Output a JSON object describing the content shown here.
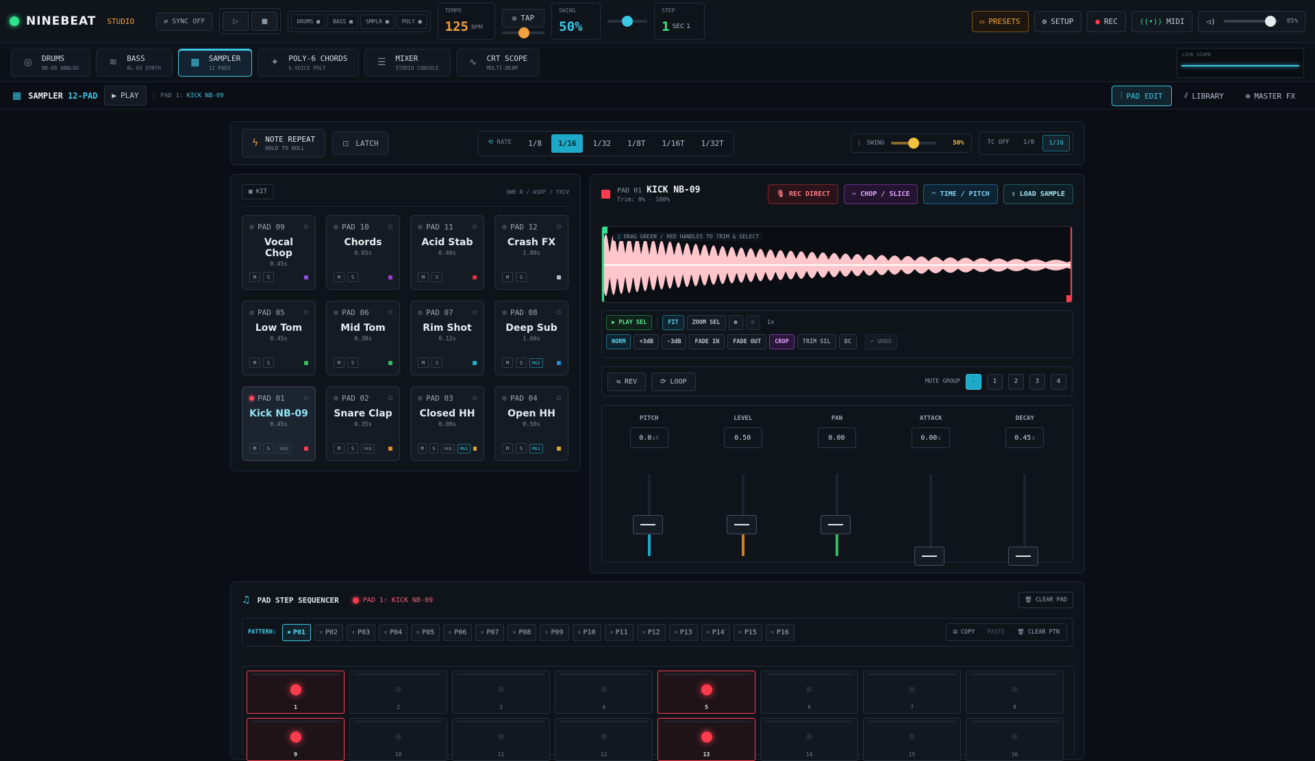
{
  "app": {
    "name": "NINEBEAT",
    "sub": "STUDIO"
  },
  "topbar": {
    "sync": "SYNC OFF",
    "channels": [
      "DRUMS",
      "BASS",
      "SMPLR",
      "POLY"
    ],
    "tempo": {
      "label": "TEMPO",
      "value": "125",
      "unit": "BPM"
    },
    "tap": "TAP",
    "swing": {
      "label": "SWING",
      "value": "50%"
    },
    "step": {
      "label": "STEP",
      "value": "1",
      "sec": "SEC 1"
    },
    "presets": "PRESETS",
    "setup": "SETUP",
    "rec": "REC",
    "midi": "MIDI",
    "volume": "85%",
    "volume_level": 0.85
  },
  "modules": [
    {
      "name": "DRUMS",
      "sub": "NB-09 ANALOG",
      "icon": "drum-icon"
    },
    {
      "name": "BASS",
      "sub": "AL-03 SYNTH",
      "icon": "bass-icon"
    },
    {
      "name": "SAMPLER",
      "sub": "12 PADS",
      "icon": "grid-icon"
    },
    {
      "name": "POLY-6 CHORDS",
      "sub": "6-VOICE POLY",
      "icon": "sparkle-icon"
    },
    {
      "name": "MIXER",
      "sub": "STUDIO CONSOLE",
      "icon": "sliders-icon"
    },
    {
      "name": "CRT SCOPE",
      "sub": "MULTI-BEAM",
      "icon": "pulse-icon"
    }
  ],
  "live_scope": "LIVE SCOPE",
  "sampler_bar": {
    "title": "SAMPLER",
    "title_accent": "12-PAD",
    "play": "PLAY",
    "pad_prefix": "PAD 1:",
    "pad_name": "KICK NB-09",
    "views": [
      "PAD EDIT",
      "LIBRARY",
      "MASTER FX"
    ]
  },
  "note_repeat": {
    "title": "NOTE REPEAT",
    "sub": "HOLD TO ROLL",
    "latch": "LATCH",
    "rate_label": "RATE",
    "rates": [
      "1/8",
      "1/16",
      "1/32",
      "1/8T",
      "1/16T",
      "1/32T"
    ],
    "swing_label": "SWING",
    "swing_value": "50%",
    "swing_level": 0.5,
    "tc": [
      "TC OFF",
      "1/8",
      "1/16"
    ]
  },
  "kit": {
    "label": "KIT",
    "keys": "QWE R / ASDF / YXCV",
    "pads": [
      {
        "id": "PAD 09",
        "name": "Vocal Chop",
        "time": "0.45s",
        "dot": "#8b4fe0",
        "tags": []
      },
      {
        "id": "PAD 10",
        "name": "Chords",
        "time": "0.65s",
        "dot": "#a03bd6",
        "tags": []
      },
      {
        "id": "PAD 11",
        "name": "Acid Stab",
        "time": "0.40s",
        "dot": "#e03447",
        "tags": []
      },
      {
        "id": "PAD 12",
        "name": "Crash FX",
        "time": "1.80s",
        "dot": "#b8bfc8",
        "tags": []
      },
      {
        "id": "PAD 05",
        "name": "Low Tom",
        "time": "0.45s",
        "dot": "#2fbf5f",
        "tags": []
      },
      {
        "id": "PAD 06",
        "name": "Mid Tom",
        "time": "0.38s",
        "dot": "#2fbf5f",
        "tags": []
      },
      {
        "id": "PAD 07",
        "name": "Rim Shot",
        "time": "0.12s",
        "dot": "#1fb3cf",
        "tags": []
      },
      {
        "id": "PAD 08",
        "name": "Deep Sub",
        "time": "1.60s",
        "dot": "#1f8fd6",
        "tags": [
          "MG2"
        ]
      },
      {
        "id": "PAD 01",
        "name": "Kick NB-09",
        "time": "0.45s",
        "dot": "#ff3b4e",
        "tags": [
          "SEQ"
        ],
        "active": true
      },
      {
        "id": "PAD 02",
        "name": "Snare Clap",
        "time": "0.35s",
        "dot": "#e08a2b",
        "tags": [
          "SEQ"
        ]
      },
      {
        "id": "PAD 03",
        "name": "Closed HH",
        "time": "0.08s",
        "dot": "#e0a62b",
        "tags": [
          "SEQ",
          "MG1"
        ]
      },
      {
        "id": "PAD 04",
        "name": "Open HH",
        "time": "0.50s",
        "dot": "#e0a62b",
        "tags": [
          "MG1"
        ]
      }
    ]
  },
  "editor": {
    "pad": "PAD 01",
    "name": "KICK NB-09",
    "trim": "Trim: 0% - 100%",
    "rec_direct": "REC DIRECT",
    "chop": "CHOP / SLICE",
    "time_pitch": "TIME / PITCH",
    "load": "LOAD SAMPLE",
    "wave_hint": "DRAG GREEN / RED HANDLES TO TRIM & SELECT",
    "tools_row1": [
      "PLAY SEL",
      "FIT",
      "ZOOM SEL",
      "1x"
    ],
    "tools_row2": [
      "NORM",
      "+3dB",
      "-3dB",
      "FADE IN",
      "FADE OUT",
      "CROP",
      "TRIM SIL",
      "DC",
      "UNDO"
    ],
    "rev": "REV",
    "loop": "LOOP",
    "mute_group_label": "MUTE GROUP",
    "mute_groups": [
      "-",
      "1",
      "2",
      "3",
      "4"
    ],
    "params": [
      {
        "label": "PITCH",
        "value": "0.0",
        "unit": "st",
        "level": 0.5,
        "color": "#1fa9c8"
      },
      {
        "label": "LEVEL",
        "value": "0.50",
        "unit": "",
        "level": 0.5,
        "color": "#c9821f"
      },
      {
        "label": "PAN",
        "value": "0.00",
        "unit": "",
        "level": 0.5,
        "color": "#2fbf5f"
      },
      {
        "label": "ATTACK",
        "value": "0.00",
        "unit": "s",
        "level": 0.0,
        "color": "#46505e"
      },
      {
        "label": "DECAY",
        "value": "0.45",
        "unit": "s",
        "level": 0.08,
        "color": "#46505e"
      }
    ]
  },
  "sequencer": {
    "title": "PAD STEP SEQUENCER",
    "pad": "PAD 1: KICK NB-09",
    "clear_pad": "CLEAR PAD",
    "pattern_label": "PATTERN:",
    "patterns": [
      "P01",
      "P02",
      "P03",
      "P04",
      "P05",
      "P06",
      "P07",
      "P08",
      "P09",
      "P10",
      "P11",
      "P12",
      "P13",
      "P14",
      "P15",
      "P16"
    ],
    "copy": "COPY",
    "paste": "PASTE",
    "clear_ptn": "CLEAR PTN",
    "steps_row1": [
      {
        "n": "1",
        "on": true
      },
      {
        "n": "2",
        "on": false
      },
      {
        "n": "3",
        "on": false
      },
      {
        "n": "4",
        "on": false
      },
      {
        "n": "5",
        "on": true
      },
      {
        "n": "6",
        "on": false
      },
      {
        "n": "7",
        "on": false
      },
      {
        "n": "8",
        "on": false
      }
    ],
    "steps_row2": [
      {
        "n": "9",
        "on": true
      },
      {
        "n": "10",
        "on": false
      },
      {
        "n": "11",
        "on": false
      },
      {
        "n": "12",
        "on": false
      },
      {
        "n": "13",
        "on": true
      },
      {
        "n": "14",
        "on": false
      },
      {
        "n": "15",
        "on": false
      },
      {
        "n": "16",
        "on": false
      }
    ]
  }
}
